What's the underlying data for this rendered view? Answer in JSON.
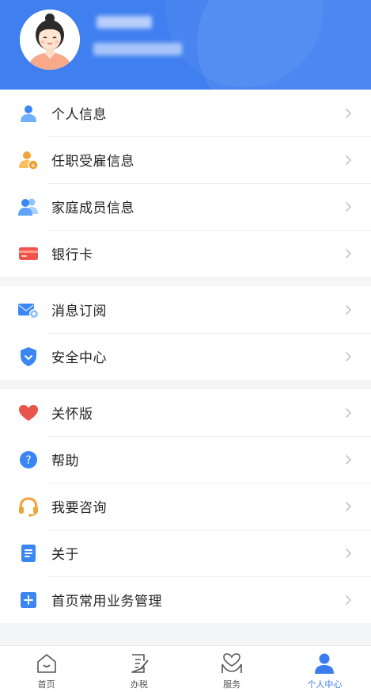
{
  "menu_groups": [
    {
      "items": [
        {
          "label": "个人信息",
          "icon": "person-icon"
        },
        {
          "label": "任职受雇信息",
          "icon": "employment-icon"
        },
        {
          "label": "家庭成员信息",
          "icon": "family-icon"
        },
        {
          "label": "银行卡",
          "icon": "bank-card-icon"
        }
      ]
    },
    {
      "items": [
        {
          "label": "消息订阅",
          "icon": "message-subscribe-icon"
        },
        {
          "label": "安全中心",
          "icon": "shield-icon"
        }
      ]
    },
    {
      "items": [
        {
          "label": "关怀版",
          "icon": "heart-icon"
        },
        {
          "label": "帮助",
          "icon": "help-icon"
        },
        {
          "label": "我要咨询",
          "icon": "headset-icon"
        },
        {
          "label": "关于",
          "icon": "document-icon"
        },
        {
          "label": "首页常用业务管理",
          "icon": "plus-square-icon"
        }
      ]
    }
  ],
  "tabbar": {
    "tabs": [
      {
        "label": "首页",
        "icon": "home-icon",
        "active": false
      },
      {
        "label": "办税",
        "icon": "tax-form-icon",
        "active": false
      },
      {
        "label": "服务",
        "icon": "service-heart-icon",
        "active": false
      },
      {
        "label": "个人中心",
        "icon": "person-filled-icon",
        "active": true
      }
    ]
  },
  "colors": {
    "header_blue": "#3f7ff0",
    "accent_blue": "#3a7df0",
    "chevron": "#c4c4c4"
  }
}
